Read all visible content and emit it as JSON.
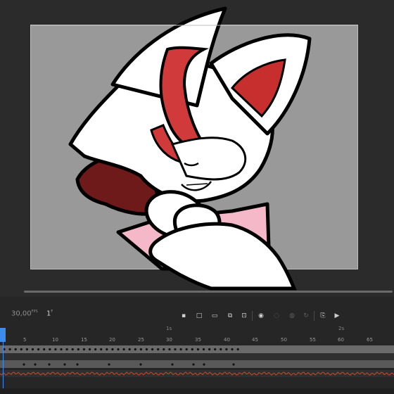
{
  "timeline": {
    "fps": "30,00",
    "fps_unit": "FPS",
    "current_frame": "1",
    "frame_unit": "F",
    "ruler": [
      "5",
      "10",
      "15",
      "20",
      "25",
      "30",
      "35",
      "40",
      "45",
      "50",
      "55",
      "60",
      "65"
    ],
    "seconds": [
      "1s",
      "2s"
    ]
  },
  "toolbar_icons": [
    "insert-keyframe-icon",
    "insert-blank-keyframe-icon",
    "clear-keyframe-icon",
    "motion-tween-icon",
    "classic-tween-icon",
    "onion-skin-icon",
    "onion-skin-outline-icon",
    "edit-multiple-frames-icon",
    "loop-icon",
    "camera-icon",
    "play-icon"
  ],
  "colors": {
    "canvas": "#999999",
    "accent_playhead": "#3c8cf0",
    "fur_red": "#d03a3a",
    "hair_brown": "#7a1e1e",
    "shirt_pink": "#f2b6c6",
    "audio_wave": "#c84b2a"
  }
}
